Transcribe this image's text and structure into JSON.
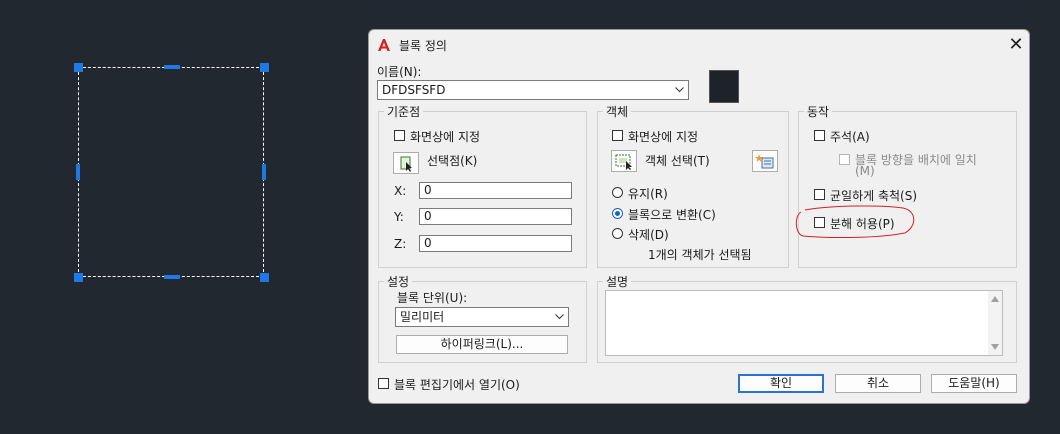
{
  "dialog": {
    "title": "블록 정의",
    "close_glyph": "✕",
    "name_label": "이름(N):",
    "name_value": "DFDSFSFD",
    "preview_color": "#1e2329"
  },
  "base_point": {
    "title": "기준점",
    "specify_on_screen": "화면상에 지정",
    "pick_point": "선택점(K)",
    "x_label": "X:",
    "x_value": "0",
    "y_label": "Y:",
    "y_value": "0",
    "z_label": "Z:",
    "z_value": "0"
  },
  "objects": {
    "title": "객체",
    "specify_on_screen": "화면상에 지정",
    "select_objects": "객체 선택(T)",
    "retain": "유지(R)",
    "convert": "블록으로 변환(C)",
    "delete": "삭제(D)",
    "selected_count": "1개의 객체가 선택됨"
  },
  "behavior": {
    "title": "동작",
    "annotative": "주석(A)",
    "match_orientation": "블록 방향을 배치에 일치",
    "match_orientation_suffix": "(M)",
    "scale_uniformly": "균일하게 축척(S)",
    "allow_exploding": "분해 허용(P)"
  },
  "settings": {
    "title": "설정",
    "block_unit_label": "블록 단위(U):",
    "block_unit_value": "밀리미터",
    "hyperlink": "하이퍼링크(L)..."
  },
  "description": {
    "title": "설명"
  },
  "footer": {
    "open_in_editor": "블록 편집기에서 열기(O)",
    "ok": "확인",
    "cancel": "취소",
    "help": "도움말(H)"
  },
  "colors": {
    "canvas_bg": "#212830",
    "grip_blue": "#1e78e6",
    "annotation_red": "#d42020"
  }
}
